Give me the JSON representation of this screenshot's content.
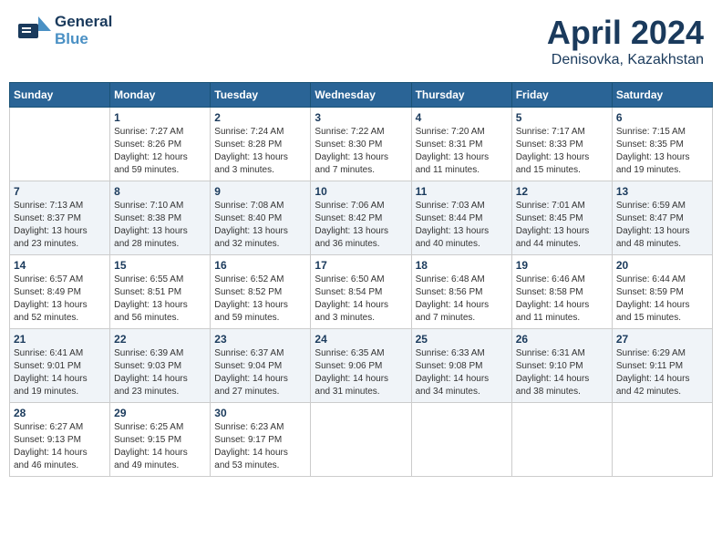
{
  "header": {
    "logo_line1": "General",
    "logo_line2": "Blue",
    "month_title": "April 2024",
    "subtitle": "Denisovka, Kazakhstan"
  },
  "days_of_week": [
    "Sunday",
    "Monday",
    "Tuesday",
    "Wednesday",
    "Thursday",
    "Friday",
    "Saturday"
  ],
  "weeks": [
    {
      "days": [
        {
          "number": "",
          "info": ""
        },
        {
          "number": "1",
          "info": "Sunrise: 7:27 AM\nSunset: 8:26 PM\nDaylight: 12 hours\nand 59 minutes."
        },
        {
          "number": "2",
          "info": "Sunrise: 7:24 AM\nSunset: 8:28 PM\nDaylight: 13 hours\nand 3 minutes."
        },
        {
          "number": "3",
          "info": "Sunrise: 7:22 AM\nSunset: 8:30 PM\nDaylight: 13 hours\nand 7 minutes."
        },
        {
          "number": "4",
          "info": "Sunrise: 7:20 AM\nSunset: 8:31 PM\nDaylight: 13 hours\nand 11 minutes."
        },
        {
          "number": "5",
          "info": "Sunrise: 7:17 AM\nSunset: 8:33 PM\nDaylight: 13 hours\nand 15 minutes."
        },
        {
          "number": "6",
          "info": "Sunrise: 7:15 AM\nSunset: 8:35 PM\nDaylight: 13 hours\nand 19 minutes."
        }
      ]
    },
    {
      "days": [
        {
          "number": "7",
          "info": "Sunrise: 7:13 AM\nSunset: 8:37 PM\nDaylight: 13 hours\nand 23 minutes."
        },
        {
          "number": "8",
          "info": "Sunrise: 7:10 AM\nSunset: 8:38 PM\nDaylight: 13 hours\nand 28 minutes."
        },
        {
          "number": "9",
          "info": "Sunrise: 7:08 AM\nSunset: 8:40 PM\nDaylight: 13 hours\nand 32 minutes."
        },
        {
          "number": "10",
          "info": "Sunrise: 7:06 AM\nSunset: 8:42 PM\nDaylight: 13 hours\nand 36 minutes."
        },
        {
          "number": "11",
          "info": "Sunrise: 7:03 AM\nSunset: 8:44 PM\nDaylight: 13 hours\nand 40 minutes."
        },
        {
          "number": "12",
          "info": "Sunrise: 7:01 AM\nSunset: 8:45 PM\nDaylight: 13 hours\nand 44 minutes."
        },
        {
          "number": "13",
          "info": "Sunrise: 6:59 AM\nSunset: 8:47 PM\nDaylight: 13 hours\nand 48 minutes."
        }
      ]
    },
    {
      "days": [
        {
          "number": "14",
          "info": "Sunrise: 6:57 AM\nSunset: 8:49 PM\nDaylight: 13 hours\nand 52 minutes."
        },
        {
          "number": "15",
          "info": "Sunrise: 6:55 AM\nSunset: 8:51 PM\nDaylight: 13 hours\nand 56 minutes."
        },
        {
          "number": "16",
          "info": "Sunrise: 6:52 AM\nSunset: 8:52 PM\nDaylight: 13 hours\nand 59 minutes."
        },
        {
          "number": "17",
          "info": "Sunrise: 6:50 AM\nSunset: 8:54 PM\nDaylight: 14 hours\nand 3 minutes."
        },
        {
          "number": "18",
          "info": "Sunrise: 6:48 AM\nSunset: 8:56 PM\nDaylight: 14 hours\nand 7 minutes."
        },
        {
          "number": "19",
          "info": "Sunrise: 6:46 AM\nSunset: 8:58 PM\nDaylight: 14 hours\nand 11 minutes."
        },
        {
          "number": "20",
          "info": "Sunrise: 6:44 AM\nSunset: 8:59 PM\nDaylight: 14 hours\nand 15 minutes."
        }
      ]
    },
    {
      "days": [
        {
          "number": "21",
          "info": "Sunrise: 6:41 AM\nSunset: 9:01 PM\nDaylight: 14 hours\nand 19 minutes."
        },
        {
          "number": "22",
          "info": "Sunrise: 6:39 AM\nSunset: 9:03 PM\nDaylight: 14 hours\nand 23 minutes."
        },
        {
          "number": "23",
          "info": "Sunrise: 6:37 AM\nSunset: 9:04 PM\nDaylight: 14 hours\nand 27 minutes."
        },
        {
          "number": "24",
          "info": "Sunrise: 6:35 AM\nSunset: 9:06 PM\nDaylight: 14 hours\nand 31 minutes."
        },
        {
          "number": "25",
          "info": "Sunrise: 6:33 AM\nSunset: 9:08 PM\nDaylight: 14 hours\nand 34 minutes."
        },
        {
          "number": "26",
          "info": "Sunrise: 6:31 AM\nSunset: 9:10 PM\nDaylight: 14 hours\nand 38 minutes."
        },
        {
          "number": "27",
          "info": "Sunrise: 6:29 AM\nSunset: 9:11 PM\nDaylight: 14 hours\nand 42 minutes."
        }
      ]
    },
    {
      "days": [
        {
          "number": "28",
          "info": "Sunrise: 6:27 AM\nSunset: 9:13 PM\nDaylight: 14 hours\nand 46 minutes."
        },
        {
          "number": "29",
          "info": "Sunrise: 6:25 AM\nSunset: 9:15 PM\nDaylight: 14 hours\nand 49 minutes."
        },
        {
          "number": "30",
          "info": "Sunrise: 6:23 AM\nSunset: 9:17 PM\nDaylight: 14 hours\nand 53 minutes."
        },
        {
          "number": "",
          "info": ""
        },
        {
          "number": "",
          "info": ""
        },
        {
          "number": "",
          "info": ""
        },
        {
          "number": "",
          "info": ""
        }
      ]
    }
  ]
}
